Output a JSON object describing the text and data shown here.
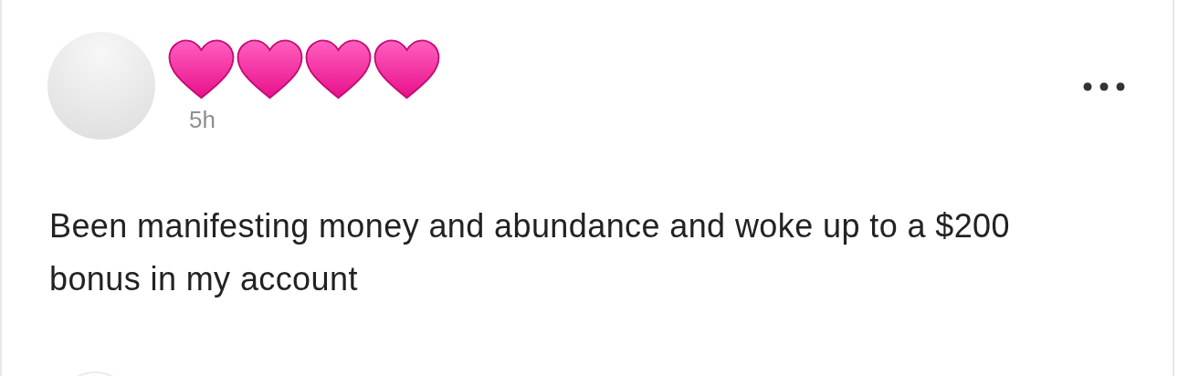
{
  "post": {
    "time": "5h",
    "text": "Been manifesting money and abundance and woke up to a $200 bonus in my account"
  }
}
